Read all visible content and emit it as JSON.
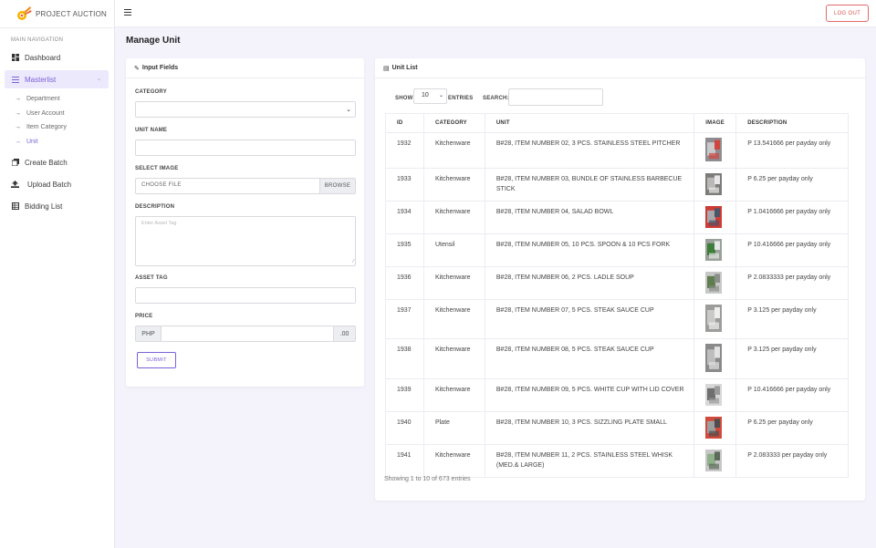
{
  "brand": {
    "name": "PROJECT AUCTION"
  },
  "topbar": {
    "logout_label": "LOG OUT"
  },
  "sidebar": {
    "header": "MAIN NAVIGATION",
    "dashboard": "Dashboard",
    "masterlist": "Masterlist",
    "sub_items": [
      "Department",
      "User Account",
      "Item Category",
      "Unit"
    ],
    "create_batch": "Create Batch",
    "upload_batch": "Upload Batch",
    "bidding_list": "Bidding List"
  },
  "page": {
    "title": "Manage Unit"
  },
  "form": {
    "title": "Input Fields",
    "category_label": "CATEGORY",
    "category_value": "",
    "unit_name_label": "UNIT NAME",
    "image_label": "SELECT IMAGE",
    "file_text": "CHOOSE FILE",
    "browse_label": "BROWSE",
    "description_label": "DESCRIPTION",
    "description_placeholder": "Enter Asset Tag",
    "asset_tag_label": "ASSET TAG",
    "price_label": "PRICE",
    "price_prefix": "PHP",
    "price_suffix": ".00",
    "submit_label": "SUBMIT"
  },
  "list": {
    "title": "Unit List",
    "show_label": "SHOW",
    "entries_value": "10",
    "entries_label": "ENTRIES",
    "search_label": "SEARCH:",
    "columns": [
      "ID",
      "CATEGORY",
      "UNIT",
      "IMAGE",
      "DESCRIPTION"
    ],
    "rows": [
      {
        "id": "1932",
        "category": "Kitchenware",
        "unit": "B#28, ITEM NUMBER 02, 3 PCS. STAINLESS STEEL PITCHER",
        "description": "P 13.541666 per payday only"
      },
      {
        "id": "1933",
        "category": "Kitchenware",
        "unit": "B#28, ITEM NUMBER 03, BUNDLE OF STAINLESS BARBECUE STICK",
        "description": "P 6.25 per payday only"
      },
      {
        "id": "1934",
        "category": "Kitchenware",
        "unit": "B#28, ITEM NUMBER 04, SALAD BOWL",
        "description": "P 1.0416666 per payday only"
      },
      {
        "id": "1935",
        "category": "Utensil",
        "unit": "B#28, ITEM NUMBER 05, 10 PCS. SPOON & 10 PCS FORK",
        "description": "P 10.416666 per payday only"
      },
      {
        "id": "1936",
        "category": "Kitchenware",
        "unit": "B#28, ITEM NUMBER 06, 2 PCS. LADLE SOUP",
        "description": "P 2.0833333 per payday only"
      },
      {
        "id": "1937",
        "category": "Kitchenware",
        "unit": "B#28, ITEM NUMBER 07, 5 PCS. STEAK SAUCE CUP",
        "description": "P 3.125 per payday only"
      },
      {
        "id": "1938",
        "category": "Kitchenware",
        "unit": "B#28, ITEM NUMBER 08, 5 PCS. STEAK SAUCE CUP",
        "description": "P 3.125 per payday only"
      },
      {
        "id": "1939",
        "category": "Kitchenware",
        "unit": "B#28, ITEM NUMBER 09, 5 PCS. WHITE CUP WITH LID COVER",
        "description": "P 10.416666 per payday only"
      },
      {
        "id": "1940",
        "category": "Plate",
        "unit": "B#28, ITEM NUMBER 10, 3 PCS. SIZZLING PLATE SMALL",
        "description": "P 6.25 per payday only"
      },
      {
        "id": "1941",
        "category": "Kitchenware",
        "unit": "B#28, ITEM NUMBER 11, 2 PCS. STAINLESS STEEL WHISK (MED.& LARGE)",
        "description": "P 2.083333 per payday only"
      }
    ],
    "footer": "Showing 1 to 10 of 673 entries"
  },
  "colors": {
    "accent": "#7b61d8",
    "danger": "#d45555",
    "background": "#f4f3fb"
  }
}
